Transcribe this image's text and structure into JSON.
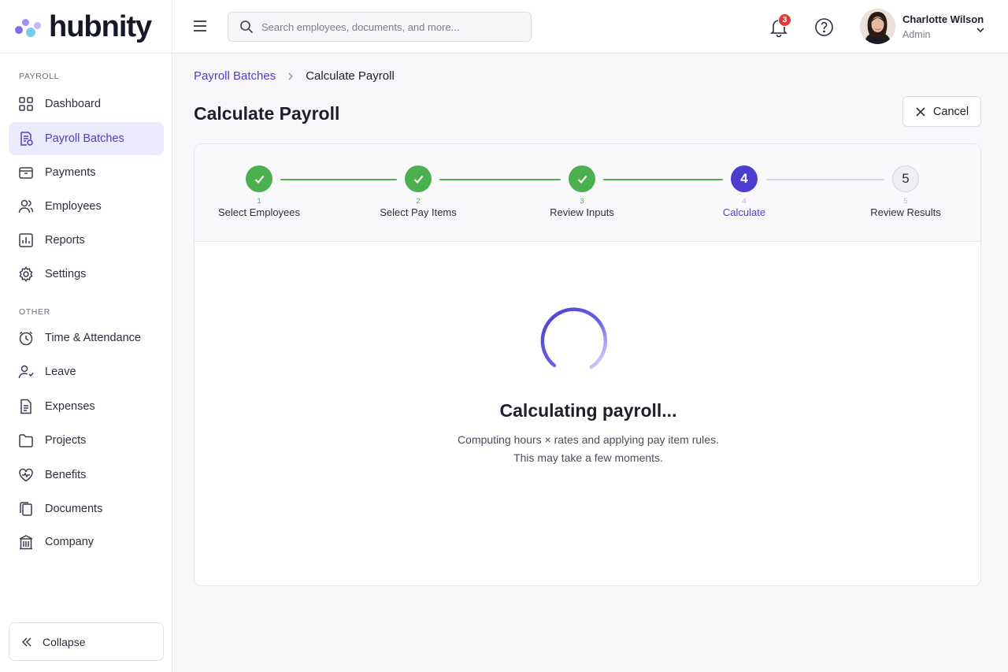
{
  "brand": {
    "name": "hubnity",
    "logo_colors": [
      "#7b6cf0",
      "#5ec6e8",
      "#a58bf5",
      "#4b3fd0"
    ]
  },
  "colors": {
    "accent": "#4b3fd0",
    "success": "#4caf50",
    "danger": "#e53935"
  },
  "sidebar": {
    "sections": [
      {
        "label": "PAYROLL",
        "items": [
          {
            "label": "Dashboard",
            "icon": "grid-icon",
            "active": false
          },
          {
            "label": "Payroll Batches",
            "icon": "receipt-icon",
            "active": true
          },
          {
            "label": "Payments",
            "icon": "wallet-icon",
            "active": false
          },
          {
            "label": "Employees",
            "icon": "users-icon",
            "active": false
          },
          {
            "label": "Reports",
            "icon": "chart-icon",
            "active": false
          },
          {
            "label": "Settings",
            "icon": "gear-icon",
            "active": false
          }
        ]
      },
      {
        "label": "OTHER",
        "items": [
          {
            "label": "Time & Attendance",
            "icon": "clock-icon",
            "active": false
          },
          {
            "label": "Leave",
            "icon": "user-leave-icon",
            "active": false
          },
          {
            "label": "Expenses",
            "icon": "document-icon",
            "active": false
          },
          {
            "label": "Projects",
            "icon": "folder-icon",
            "active": false
          },
          {
            "label": "Benefits",
            "icon": "heart-icon",
            "active": false
          },
          {
            "label": "Documents",
            "icon": "copy-icon",
            "active": false
          },
          {
            "label": "Company",
            "icon": "building-icon",
            "active": false
          }
        ]
      }
    ],
    "collapse_label": "Collapse"
  },
  "topbar": {
    "search_placeholder": "Search employees, documents, and more...",
    "notification_count": "3",
    "user": {
      "name": "Charlotte Wilson",
      "role": "Admin"
    }
  },
  "breadcrumb": {
    "parent": "Payroll Batches",
    "current": "Calculate Payroll"
  },
  "page": {
    "title": "Calculate Payroll",
    "cancel_label": "Cancel"
  },
  "stepper": {
    "steps": [
      {
        "number": "1",
        "label": "Select Employees",
        "status": "done"
      },
      {
        "number": "2",
        "label": "Select Pay Items",
        "status": "done"
      },
      {
        "number": "3",
        "label": "Review Inputs",
        "status": "done"
      },
      {
        "number": "4",
        "label": "Calculate",
        "status": "active"
      },
      {
        "number": "5",
        "label": "Review Results",
        "status": "todo"
      }
    ]
  },
  "loading": {
    "title": "Calculating payroll...",
    "line1": "Computing hours × rates and applying pay item rules.",
    "line2": "This may take a few moments."
  }
}
